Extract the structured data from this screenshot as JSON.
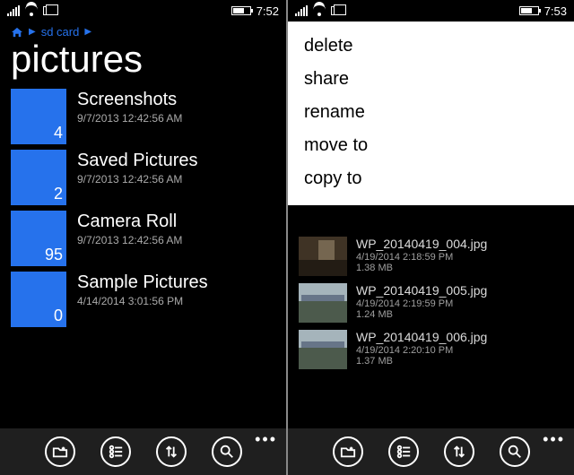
{
  "left": {
    "status": {
      "time": "7:52"
    },
    "breadcrumb": {
      "root": "sd card"
    },
    "title": "pictures",
    "folders": [
      {
        "name": "Screenshots",
        "date": "9/7/2013 12:42:56 AM",
        "count": "4"
      },
      {
        "name": "Saved Pictures",
        "date": "9/7/2013 12:42:56 AM",
        "count": "2"
      },
      {
        "name": "Camera Roll",
        "date": "9/7/2013 12:42:56 AM",
        "count": "95"
      },
      {
        "name": "Sample Pictures",
        "date": "4/14/2014 3:01:56 PM",
        "count": "0"
      }
    ]
  },
  "right": {
    "status": {
      "time": "7:53"
    },
    "menu": {
      "items": [
        "delete",
        "share",
        "rename",
        "move to",
        "copy to"
      ]
    },
    "files": [
      {
        "name": "WP_20140419_004.jpg",
        "date": "4/19/2014 2:18:59 PM",
        "size": "1.38 MB",
        "thumb": "indoor"
      },
      {
        "name": "WP_20140419_005.jpg",
        "date": "4/19/2014 2:19:59 PM",
        "size": "1.24 MB",
        "thumb": "outdoor"
      },
      {
        "name": "WP_20140419_006.jpg",
        "date": "4/19/2014 2:20:10 PM",
        "size": "1.37 MB",
        "thumb": "outdoor"
      }
    ]
  },
  "appbar": {
    "icons": [
      "new-folder",
      "select",
      "sort",
      "search"
    ]
  }
}
